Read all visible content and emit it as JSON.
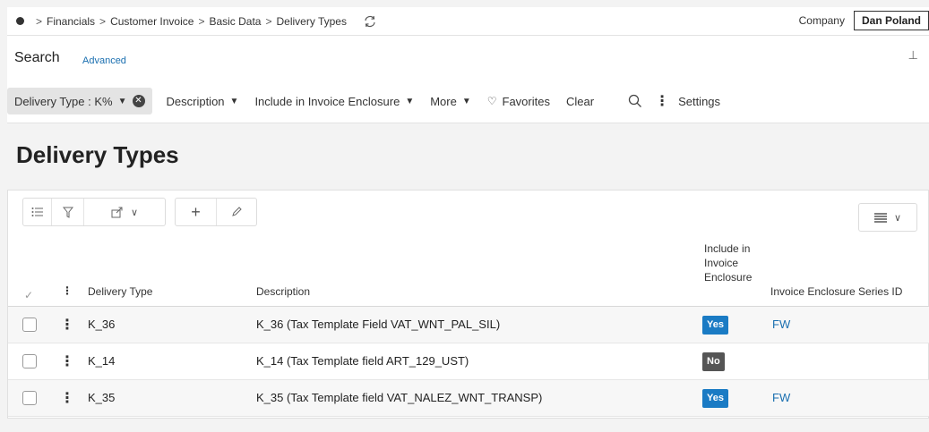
{
  "breadcrumb": {
    "items": [
      "Financials",
      "Customer Invoice",
      "Basic Data",
      "Delivery Types"
    ],
    "sep": ">"
  },
  "company": {
    "label": "Company",
    "value": "Dan Poland"
  },
  "search": {
    "title": "Search",
    "advanced": "Advanced",
    "chip": "Delivery Type : K%",
    "filters": [
      "Description",
      "Include in Invoice Enclosure",
      "More"
    ],
    "favorites": "Favorites",
    "clear": "Clear",
    "settings": "Settings"
  },
  "page": {
    "title": "Delivery Types"
  },
  "table": {
    "columns": {
      "delivery_type": "Delivery Type",
      "description": "Description",
      "include": "Include in\nInvoice\nEnclosure",
      "series": "Invoice Enclosure Series ID"
    },
    "rows": [
      {
        "delivery_type": "K_36",
        "description": "K_36 (Tax Template Field VAT_WNT_PAL_SIL)",
        "include": "Yes",
        "series": "FW"
      },
      {
        "delivery_type": "K_14",
        "description": "K_14 (Tax Template field ART_129_UST)",
        "include": "No",
        "series": ""
      },
      {
        "delivery_type": "K_35",
        "description": "K_35 (Tax Template field VAT_NALEZ_WNT_TRANSP)",
        "include": "Yes",
        "series": "FW"
      }
    ]
  },
  "colors": {
    "accent": "#1a7bc4",
    "link": "#1a6fb0",
    "no_badge": "#555555"
  }
}
